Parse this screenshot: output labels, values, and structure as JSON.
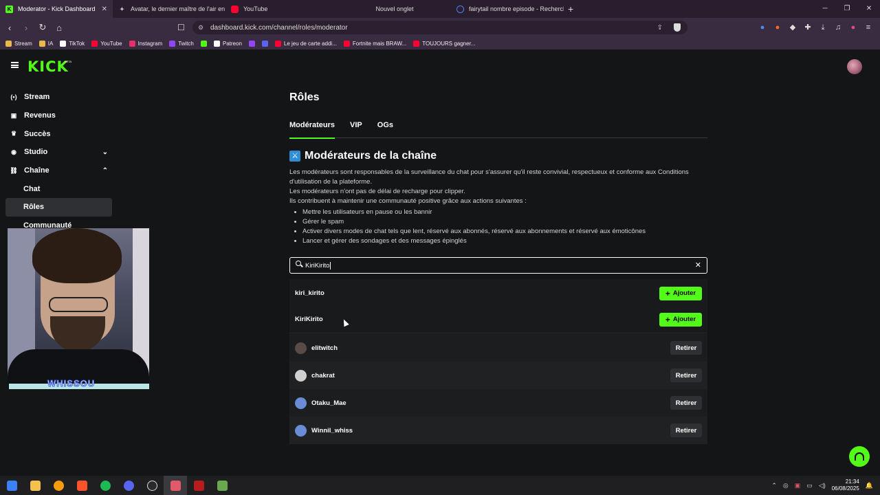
{
  "browser": {
    "tabs": [
      {
        "title": "Moderator - Kick Dashboard",
        "active": true,
        "color": "#53fc18"
      },
      {
        "title": "Avatar, le dernier maître de l'air en st",
        "active": false,
        "color": "#8a7fff"
      },
      {
        "title": "YouTube",
        "active": false,
        "color": "#ff0033"
      },
      {
        "title": "Nouvel onglet",
        "active": false,
        "color": ""
      },
      {
        "title": "fairytail nombre episode - Recherche",
        "active": false,
        "color": "#4285f4"
      }
    ],
    "new_tab": "+",
    "url": "dashboard.kick.com/channel/roles/moderator",
    "bookmarks": [
      {
        "label": "Stream",
        "color": "#e8b84a"
      },
      {
        "label": "IA",
        "color": "#e8b84a"
      },
      {
        "label": "TikTok",
        "color": "#ffffff"
      },
      {
        "label": "YouTube",
        "color": "#ff0033"
      },
      {
        "label": "Instagram",
        "color": "#e1306c"
      },
      {
        "label": "Twitch",
        "color": "#9146ff"
      },
      {
        "label": "",
        "color": "#53fc18"
      },
      {
        "label": "Patreon",
        "color": "#ffffff"
      },
      {
        "label": "",
        "color": "#9146ff"
      },
      {
        "label": "",
        "color": "#5865f2"
      },
      {
        "label": "Le jeu de carte addi...",
        "color": "#ff0033"
      },
      {
        "label": "Fortnite mais BRAW...",
        "color": "#ff0033"
      },
      {
        "label": "TOUJOURS gagner...",
        "color": "#ff0033"
      }
    ]
  },
  "app": {
    "logo": "KICK",
    "logo_badge": "BETA",
    "brand_color": "#53fc18"
  },
  "sidebar": {
    "items": [
      {
        "label": "Stream",
        "icon": "broadcast-icon",
        "glyph": "(•)"
      },
      {
        "label": "Revenus",
        "icon": "chart-icon",
        "glyph": "▣"
      },
      {
        "label": "Succès",
        "icon": "trophy-icon",
        "glyph": "🏆"
      },
      {
        "label": "Studio",
        "icon": "studio-icon",
        "glyph": "◉"
      },
      {
        "label": "Chaîne",
        "icon": "channel-icon",
        "glyph": "⛓"
      },
      {
        "label": "Chat"
      },
      {
        "label": "Rôles"
      },
      {
        "label": "Communauté"
      }
    ]
  },
  "webcam": {
    "overlay_name": "WHISSOU"
  },
  "main": {
    "title": "Rôles",
    "tabs": [
      "Modérateurs",
      "VIP",
      "OGs"
    ],
    "section_title": "Modérateurs de la chaîne",
    "desc_line1": "Les modérateurs sont responsables de la surveillance du chat pour s'assurer qu'il reste convivial, respectueux et conforme aux Conditions d'utilisation de la plateforme.",
    "desc_line2": "Les modérateurs n'ont pas de délai de recharge pour clipper.",
    "desc_line3": "Ils contribuent à maintenir une communauté positive grâce aux actions suivantes :",
    "bullets": [
      "Mettre les utilisateurs en pause ou les bannir",
      "Gérer le spam",
      "Activer divers modes de chat tels que lent, réservé aux abonnés, réservé aux abonnements et réservé aux émoticônes",
      "Lancer et gérer des sondages et des messages épinglés"
    ],
    "search_value": "KiriKirito",
    "search_results": [
      {
        "username": "kiri_kirito",
        "action": "Ajouter"
      },
      {
        "username": "KiriKirito",
        "action": "Ajouter"
      }
    ],
    "moderators": [
      {
        "username": "elitwitch",
        "action": "Retirer",
        "avatar_color": "#5a4a48"
      },
      {
        "username": "chakrat",
        "action": "Retirer",
        "avatar_color": "#d0d0d0"
      },
      {
        "username": "Otaku_Mae",
        "action": "Retirer",
        "avatar_color": "#6a8bd6"
      },
      {
        "username": "Winnil_whiss",
        "action": "Retirer",
        "avatar_color": "#6a8bd6"
      }
    ]
  },
  "taskbar": {
    "time": "21:34",
    "date": "06/08/2025"
  }
}
